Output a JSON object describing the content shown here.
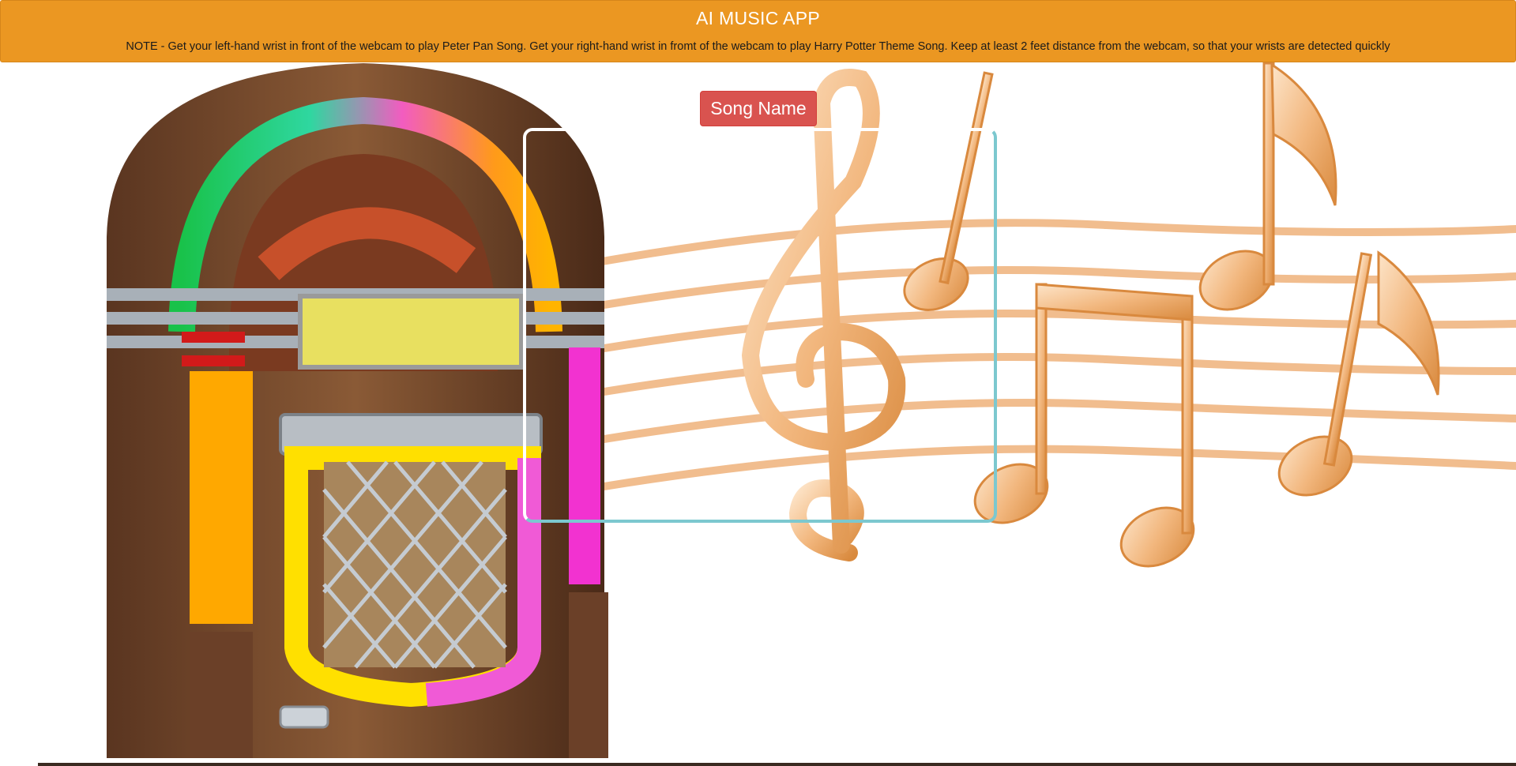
{
  "header": {
    "title": "AI MUSIC APP",
    "note": "NOTE - Get your left-hand wrist in front of the webcam to play Peter Pan Song. Get your right-hand wrist in fromt of the webcam to play Harry Potter Theme Song. Keep at least 2 feet distance from the webcam, so that your wrists are detected quickly"
  },
  "main": {
    "song_button_label": "Song Name"
  },
  "colors": {
    "header_bg": "#eb9722",
    "button_bg": "#d9534f",
    "webcam_border": "#7cc8cf"
  }
}
